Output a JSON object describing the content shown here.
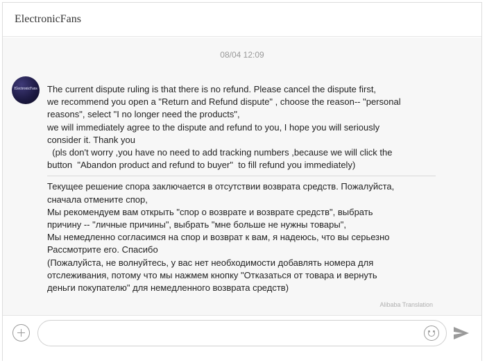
{
  "header": {
    "title": "ElectronicFans"
  },
  "conversation": {
    "timestamp": "08/04 12:09",
    "message": {
      "avatar_text": "ElectronicFans",
      "original_text": "The current dispute ruling is that there is no refund. Please cancel the dispute first,\nwe recommend you open a \"Return and Refund dispute\" , choose the reason-- \"personal\nreasons\", select \"I no longer need the products\",\nwe will immediately agree to the dispute and refund to you, I hope you will seriously\nconsider it. Thank you\n  (pls don't worry ,you have no need to add tracking numbers ,because we will click the\nbutton  \"Abandon product and refund to buyer\"  to fill refund you immediately)",
      "translated_text": "Текущее решение спора заключается в отсутствии возврата средств. Пожалуйста,\nсначала отмените спор,\nМы рекомендуем вам открыть \"спор о возврате и возврате средств\", выбрать\nпричину -- \"личные причины\", выбрать \"мне больше не нужны товары\",\nМы немедленно согласимся на спор и возврат к вам, я надеюсь, что вы серьезно\nРассмотрите его. Спасибо\n(Пожалуйста, не волнуйтесь, у вас нет необходимости добавлять номера для\nотслеживания, потому что мы нажмем кнопку \"Отказаться от товара и вернуть\nденьги покупателю\" для немедленного возврата средств)",
      "translation_label": "Alibaba Translation"
    }
  },
  "composer": {
    "input_value": "",
    "icons": {
      "add": "plus-circle-icon",
      "emoji": "smiley-icon",
      "send": "paper-plane-icon"
    }
  },
  "colors": {
    "header_text": "#333333",
    "timestamp": "#999999",
    "message_area_bg": "#f7f7f7",
    "icon_gray": "#9a9a9a"
  }
}
